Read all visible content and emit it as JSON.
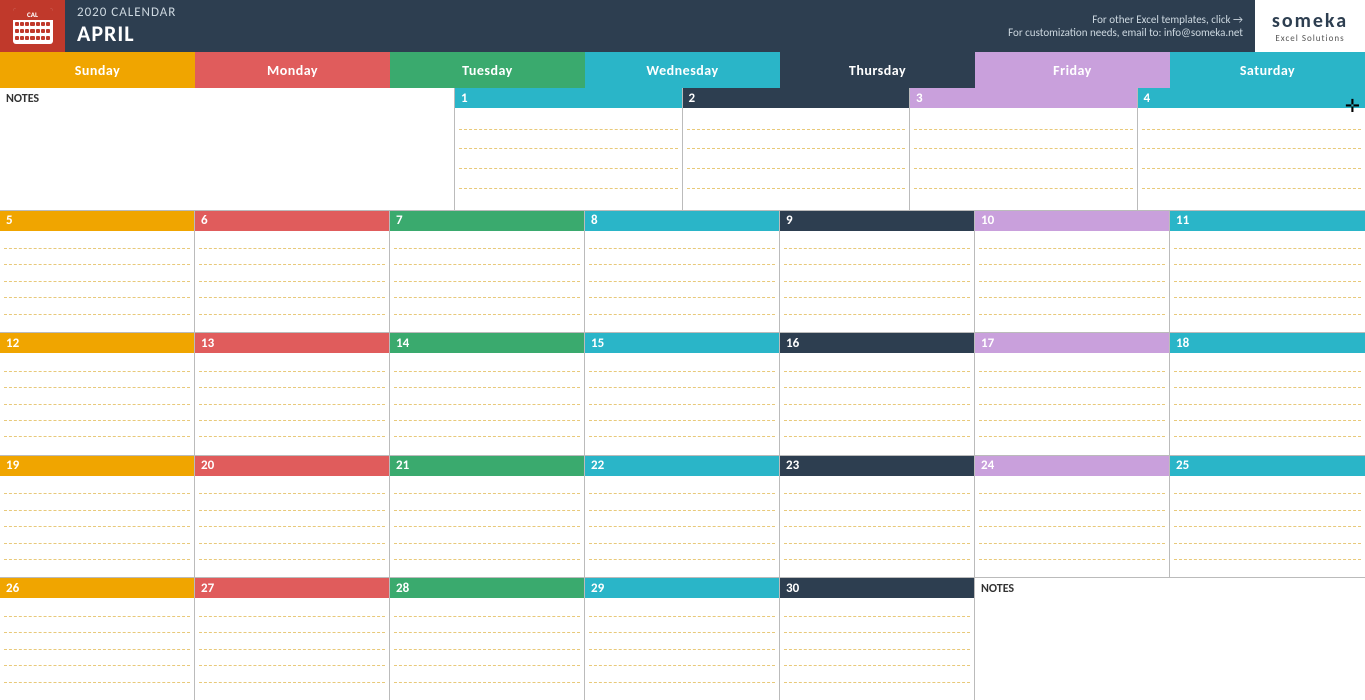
{
  "header": {
    "year": "2020",
    "title": "2020 CALENDAR",
    "month": "APRIL",
    "tagline1": "For other Excel templates, click →",
    "tagline2": "For customization needs, email to: info@someka.net",
    "brand": "someka",
    "brand_sub": "Excel Solutions"
  },
  "days": {
    "sunday": "Sunday",
    "monday": "Monday",
    "tuesday": "Tuesday",
    "wednesday": "Wednesday",
    "thursday": "Thursday",
    "friday": "Friday",
    "saturday": "Saturday"
  },
  "notes_label": "NOTES",
  "weeks": [
    {
      "notes": true,
      "days": [
        {
          "num": "1",
          "col": "wed"
        },
        {
          "num": "2",
          "col": "thu"
        },
        {
          "num": "3",
          "col": "fri"
        },
        {
          "num": "4",
          "col": "sat"
        }
      ]
    },
    {
      "days": [
        {
          "num": "5",
          "col": "sun"
        },
        {
          "num": "6",
          "col": "mon"
        },
        {
          "num": "7",
          "col": "tue"
        },
        {
          "num": "8",
          "col": "wed"
        },
        {
          "num": "9",
          "col": "thu"
        },
        {
          "num": "10",
          "col": "fri"
        },
        {
          "num": "11",
          "col": "sat"
        }
      ]
    },
    {
      "days": [
        {
          "num": "12",
          "col": "sun"
        },
        {
          "num": "13",
          "col": "mon"
        },
        {
          "num": "14",
          "col": "tue"
        },
        {
          "num": "15",
          "col": "wed"
        },
        {
          "num": "16",
          "col": "thu"
        },
        {
          "num": "17",
          "col": "fri"
        },
        {
          "num": "18",
          "col": "sat"
        }
      ]
    },
    {
      "days": [
        {
          "num": "19",
          "col": "sun"
        },
        {
          "num": "20",
          "col": "mon"
        },
        {
          "num": "21",
          "col": "tue"
        },
        {
          "num": "22",
          "col": "wed"
        },
        {
          "num": "23",
          "col": "thu"
        },
        {
          "num": "24",
          "col": "fri"
        },
        {
          "num": "25",
          "col": "sat"
        }
      ]
    },
    {
      "notes_end": true,
      "days": [
        {
          "num": "26",
          "col": "sun"
        },
        {
          "num": "27",
          "col": "mon"
        },
        {
          "num": "28",
          "col": "tue"
        },
        {
          "num": "29",
          "col": "wed"
        },
        {
          "num": "30",
          "col": "thu"
        }
      ]
    }
  ]
}
